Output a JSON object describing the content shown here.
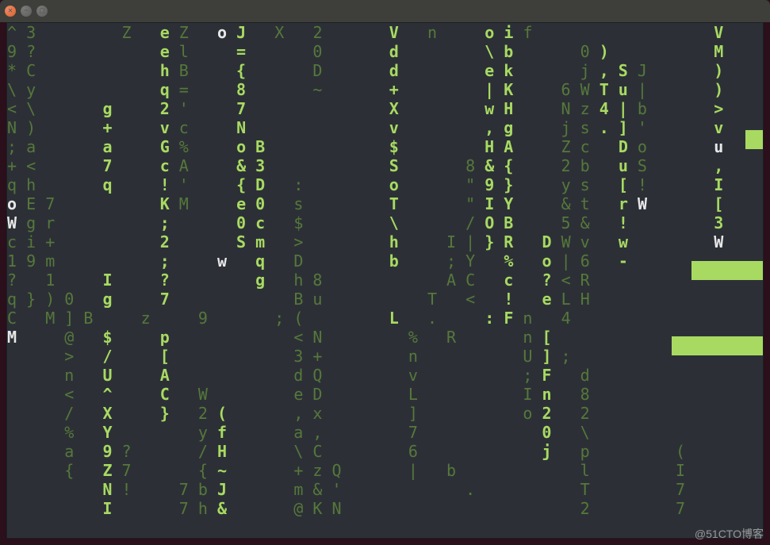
{
  "window": {
    "controls": {
      "close": "✕",
      "min": "−",
      "max": "▢"
    },
    "title": ""
  },
  "watermark": "@51CTO博客",
  "matrix": {
    "cols": 38,
    "rows": 25,
    "cells": [
      [
        "^",
        "3",
        "",
        "",
        "",
        "",
        "Z",
        "",
        "e",
        "Z",
        "",
        "o",
        "J",
        "",
        "X",
        "",
        "2",
        "",
        "",
        "",
        "V",
        "",
        "n",
        "",
        "",
        "o",
        "i",
        "f",
        "",
        "",
        "",
        "",
        "",
        "",
        "",
        "",
        "",
        "V"
      ],
      [
        "9",
        "?",
        "",
        "",
        "",
        "",
        "",
        "",
        "e",
        "l",
        "",
        "",
        "=",
        "",
        "",
        "",
        "0",
        "",
        "",
        "",
        "d",
        "",
        "",
        "",
        "",
        "\\",
        "b",
        "",
        "",
        "",
        "0",
        ")",
        "",
        "",
        "",
        "",
        "",
        "M"
      ],
      [
        "*",
        "C",
        "",
        "",
        "",
        "",
        "",
        "",
        "h",
        "B",
        "",
        "",
        "{",
        "",
        "",
        "",
        "D",
        "",
        "",
        "",
        "d",
        "",
        "",
        "",
        "",
        "e",
        "k",
        "",
        "",
        "",
        "j",
        ",",
        "S",
        "J",
        "",
        "",
        "",
        ")"
      ],
      [
        "\\",
        "y",
        "",
        "",
        "",
        "",
        "",
        "",
        "q",
        "=",
        "",
        "",
        "8",
        "",
        "",
        "",
        "~",
        "",
        "",
        "",
        "+",
        "",
        "",
        "",
        "",
        "|",
        "K",
        "",
        "",
        "6",
        "W",
        "T",
        "u",
        "|",
        "",
        "",
        "",
        ")"
      ],
      [
        "<",
        "\\",
        "",
        "",
        "",
        "g",
        "",
        "",
        "2",
        "'",
        "",
        "",
        "7",
        "",
        "",
        "",
        "",
        "",
        "",
        "",
        "X",
        "",
        "",
        "",
        "",
        "w",
        "H",
        "",
        "",
        "N",
        "z",
        "4",
        "|",
        "b",
        "",
        "",
        "",
        ">"
      ],
      [
        "N",
        ")",
        "",
        "",
        "",
        "+",
        "",
        "",
        "v",
        "c",
        "",
        "",
        "N",
        "",
        "",
        "",
        "",
        "",
        "",
        "",
        "v",
        "",
        "",
        "",
        "",
        ",",
        "g",
        "",
        "",
        "j",
        "s",
        ".",
        "]",
        "'",
        "",
        "",
        "",
        "v"
      ],
      [
        ";",
        "a",
        "",
        "",
        "",
        "a",
        "",
        "",
        "G",
        "%",
        "",
        "",
        "o",
        "B",
        "",
        "",
        "",
        "",
        "",
        "",
        "$",
        "",
        "",
        "",
        "",
        "H",
        "A",
        "",
        "",
        "Z",
        "c",
        "",
        "D",
        "o",
        "",
        "",
        "",
        "u"
      ],
      [
        "+",
        "<",
        "",
        "",
        "",
        "7",
        "",
        "",
        "c",
        "A",
        "",
        "",
        "&",
        "3",
        "",
        "",
        "",
        "",
        "",
        "",
        "S",
        "",
        "",
        "",
        "8",
        "&",
        "{",
        "",
        "",
        "2",
        "b",
        "",
        "u",
        "S",
        "",
        "",
        "",
        ","
      ],
      [
        "q",
        "h",
        "",
        "",
        "",
        "q",
        "",
        "",
        "!",
        "'",
        "",
        "",
        "{",
        "D",
        "",
        ":",
        "",
        "",
        "",
        "",
        "o",
        "",
        "",
        "",
        "\"",
        "9",
        "}",
        "",
        "",
        "y",
        "s",
        "",
        "[",
        "!",
        "",
        "",
        "",
        "I"
      ],
      [
        "o",
        "E",
        "7",
        "",
        "",
        "",
        "",
        "",
        "K",
        "M",
        "",
        "",
        "e",
        "0",
        "",
        "s",
        "",
        "",
        "",
        "",
        "T",
        "",
        "",
        "",
        "\"",
        "I",
        "Y",
        "",
        "",
        "&",
        "t",
        "",
        "r",
        "W",
        "",
        "",
        "",
        "["
      ],
      [
        "W",
        "g",
        "r",
        "",
        "",
        "",
        "",
        "",
        ";",
        "",
        "",
        "",
        "0",
        "c",
        "",
        "$",
        "",
        "",
        "",
        "",
        "\\",
        "",
        "",
        "",
        "/",
        "O",
        "B",
        "",
        "",
        "5",
        "&",
        "",
        "!",
        "",
        "",
        "",
        "",
        "3"
      ],
      [
        "c",
        "i",
        "+",
        "",
        "",
        "",
        "",
        "",
        "2",
        "",
        "",
        "",
        "S",
        "m",
        "",
        ">",
        "",
        "",
        "",
        "",
        "h",
        "",
        "",
        "I",
        "|",
        "}",
        "R",
        "",
        "D",
        "W",
        "v",
        "",
        "w",
        "",
        "",
        "",
        "",
        "W"
      ],
      [
        "1",
        "9",
        "m",
        "",
        "",
        "",
        "",
        "",
        ";",
        "",
        "",
        "w",
        "",
        "q",
        "",
        "D",
        "",
        "",
        "",
        "",
        "b",
        "",
        "",
        ";",
        "Y",
        "",
        "%",
        "",
        "o",
        "|",
        "6",
        "",
        "-",
        "",
        "",
        "",
        "",
        ""
      ],
      [
        "?",
        "",
        "1",
        "",
        "",
        "I",
        "",
        "",
        "?",
        "",
        "",
        "",
        "",
        "g",
        "",
        "h",
        "8",
        "",
        "",
        "",
        "",
        "",
        "",
        "A",
        "C",
        "",
        "c",
        "",
        "?",
        "<",
        "R",
        "",
        "",
        "",
        "",
        "",
        "",
        ""
      ],
      [
        "q",
        "}",
        ")",
        "0",
        "",
        "g",
        "",
        "",
        "7",
        "",
        "",
        "",
        "",
        "",
        "",
        "B",
        "u",
        "",
        "",
        "",
        "",
        "",
        "T",
        "",
        "<",
        "",
        "!",
        "",
        "e",
        "L",
        "H",
        "",
        "",
        "",
        "",
        "",
        "",
        ""
      ],
      [
        "C",
        "",
        "M",
        "]",
        "B",
        "",
        "",
        "z",
        "",
        "",
        "9",
        "",
        "",
        "",
        ";",
        "(",
        "",
        "",
        "",
        "",
        "L",
        "",
        ".",
        "",
        "",
        ":",
        "F",
        "n",
        "",
        "4",
        "",
        "",
        "",
        "",
        "",
        "",
        "",
        ""
      ],
      [
        "M",
        "",
        "",
        "@",
        "",
        "$",
        "",
        "",
        "p",
        "",
        "",
        "",
        "",
        "",
        "",
        "<",
        "N",
        "",
        "",
        "",
        "",
        "%",
        "",
        "R",
        "",
        "",
        "",
        "n",
        "[",
        "",
        "",
        "",
        "",
        "",
        "",
        "",
        "",
        ""
      ],
      [
        "",
        "",
        "",
        ">",
        "",
        "/",
        "",
        "",
        "[",
        "",
        "",
        "",
        "",
        "",
        "",
        "3",
        "+",
        "",
        "",
        "",
        "",
        "n",
        "",
        "",
        "",
        "",
        "",
        "U",
        "]",
        ";",
        "",
        "",
        "",
        "",
        "",
        "",
        "",
        ""
      ],
      [
        "",
        "",
        "",
        "n",
        "",
        "U",
        "",
        "",
        "A",
        "",
        "",
        "",
        "",
        "",
        "",
        "d",
        "Q",
        "",
        "",
        "",
        "",
        "v",
        "",
        "",
        "",
        "",
        "",
        ";",
        "F",
        "",
        "d",
        "",
        "",
        "",
        "",
        "",
        "",
        ""
      ],
      [
        "",
        "",
        "",
        "<",
        "",
        "^",
        "",
        "",
        "C",
        "",
        "W",
        "",
        "",
        "",
        "",
        "e",
        "D",
        "",
        "",
        "",
        "",
        "L",
        "",
        "",
        "",
        "",
        "",
        "I",
        "n",
        "",
        "8",
        "",
        "",
        "",
        "",
        "",
        "",
        ""
      ],
      [
        "",
        "",
        "",
        "/",
        "",
        "X",
        "",
        "",
        "}",
        "",
        "2",
        "(",
        "",
        "",
        "",
        ",",
        "x",
        "",
        "",
        "",
        "",
        "]",
        "",
        "",
        "",
        "",
        "",
        "o",
        "2",
        "",
        "2",
        "",
        "",
        "",
        "",
        "",
        "",
        ""
      ],
      [
        "",
        "",
        "",
        "%",
        "",
        "Y",
        "",
        "",
        "",
        "",
        "y",
        "f",
        "",
        "",
        "",
        "a",
        ",",
        "",
        "",
        "",
        "",
        "7",
        "",
        "",
        "",
        "",
        "",
        "",
        "0",
        "",
        "\\",
        "",
        "",
        "",
        "",
        "",
        "",
        ""
      ],
      [
        "",
        "",
        "",
        "a",
        "",
        "9",
        "?",
        "",
        "",
        "",
        "/",
        "H",
        "",
        "",
        "",
        "\\",
        "C",
        "",
        "",
        "",
        "",
        "6",
        "",
        "",
        "",
        "",
        "",
        "",
        "j",
        "",
        "p",
        "",
        "",
        "",
        "",
        "(",
        "",
        ""
      ],
      [
        "",
        "",
        "",
        "{",
        "",
        "Z",
        "7",
        "",
        "",
        "",
        "{",
        "~",
        "",
        "",
        "",
        "+",
        "z",
        "Q",
        "",
        "",
        "",
        "|",
        "",
        "b",
        "",
        "",
        "",
        "",
        "",
        "",
        "l",
        "",
        "",
        "",
        "",
        "I",
        "",
        ""
      ],
      [
        "",
        "",
        "",
        "",
        "",
        "N",
        "!",
        "",
        "",
        "7",
        "b",
        "J",
        "",
        "",
        "",
        "m",
        "&",
        "'",
        "",
        "",
        "",
        "",
        "",
        "",
        ".",
        "",
        "",
        "",
        "",
        "",
        "T",
        "",
        "",
        "",
        "",
        "7",
        "",
        ""
      ],
      [
        "",
        "",
        "",
        "",
        "",
        "I",
        "",
        "",
        "",
        "7",
        "h",
        "&",
        "",
        "",
        "",
        "@",
        "K",
        "N",
        "",
        "",
        "",
        "",
        "",
        "",
        "",
        "",
        "",
        "",
        "",
        "",
        "2",
        "",
        "",
        "",
        "",
        "7",
        "",
        ""
      ]
    ],
    "bright_cols": [
      5,
      8,
      11,
      12,
      13,
      20,
      25,
      26,
      28,
      31,
      32,
      37
    ],
    "white_cells": [
      [
        0,
        11
      ],
      [
        9,
        0
      ],
      [
        9,
        33
      ],
      [
        10,
        0
      ],
      [
        12,
        11
      ],
      [
        16,
        0
      ],
      [
        17,
        0
      ],
      [
        6,
        37
      ],
      [
        11,
        37
      ]
    ]
  }
}
